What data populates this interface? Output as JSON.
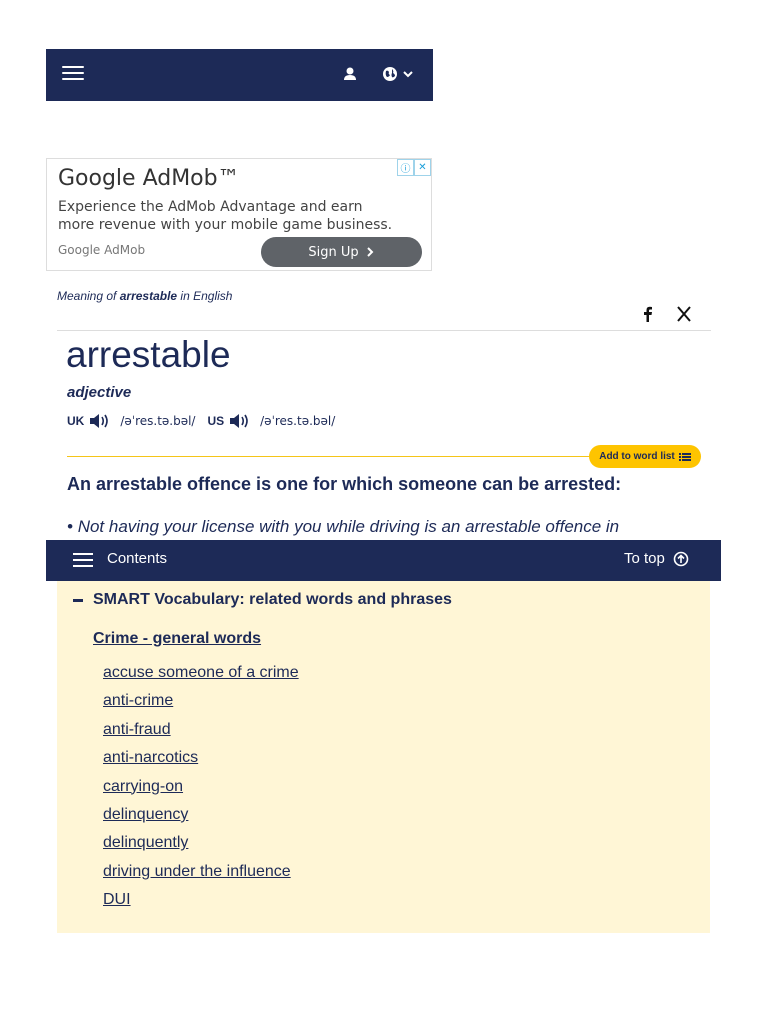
{
  "header": {
    "menu_icon": "hamburger-icon",
    "user_icon": "user-icon",
    "language_icon": "globe-icon"
  },
  "ad": {
    "title": "Google AdMob™",
    "body": "Experience the AdMob Advantage and earn more revenue with your mobile game business.",
    "source": "Google AdMob",
    "cta": "Sign Up"
  },
  "entry": {
    "meaning_prefix": "Meaning of ",
    "meaning_word": "arrestable",
    "meaning_suffix": " in English",
    "headword": "arrestable",
    "pos": "adjective",
    "uk_label": "UK",
    "uk_ipa": "/əˈres.tə.bəl/",
    "us_label": "US",
    "us_ipa": "/əˈres.tə.bəl/",
    "add_to_list": "Add to word list",
    "definition": "An arrestable offence is one for which someone can be arrested:",
    "example": "Not having your license with you while driving is an arrestable offence in"
  },
  "contents_bar": {
    "label": "Contents",
    "to_top": "To top"
  },
  "smart_vocab": {
    "heading": "SMART Vocabulary: related words and phrases",
    "category": "Crime - general words",
    "items": [
      "accuse someone of a crime",
      "anti-crime",
      "anti-fraud",
      "anti-narcotics",
      "carrying-on",
      "delinquency",
      "delinquently",
      "driving under the influence",
      "DUI"
    ]
  },
  "colors": {
    "brand": "#1d2a57",
    "accent": "#fec400",
    "smart_bg": "#fff6d6"
  }
}
